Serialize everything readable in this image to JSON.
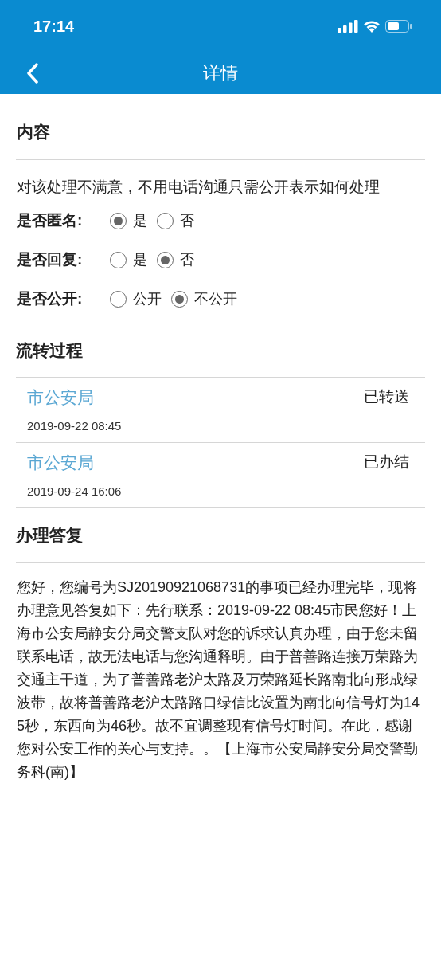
{
  "status_bar": {
    "time": "17:14"
  },
  "nav": {
    "title": "详情"
  },
  "content_section": {
    "heading": "内容",
    "text": "对该处理不满意，不用电话沟通只需公开表示如何处理",
    "fields": [
      {
        "label": "是否匿名:",
        "options": [
          {
            "label": "是",
            "selected": true
          },
          {
            "label": "否",
            "selected": false
          }
        ]
      },
      {
        "label": "是否回复:",
        "options": [
          {
            "label": "是",
            "selected": false
          },
          {
            "label": "否",
            "selected": true
          }
        ]
      },
      {
        "label": "是否公开:",
        "options": [
          {
            "label": "公开",
            "selected": false
          },
          {
            "label": "不公开",
            "selected": true
          }
        ]
      }
    ]
  },
  "flow_section": {
    "heading": "流转过程",
    "records": [
      {
        "department": "市公安局",
        "time": "2019-09-22 08:45",
        "status": "已转送"
      },
      {
        "department": "市公安局",
        "time": "2019-09-24 16:06",
        "status": "已办结"
      }
    ]
  },
  "reply_section": {
    "heading": "办理答复",
    "text": "您好，您编号为SJ20190921068731的事项已经办理完毕，现将办理意见答复如下：先行联系：2019-09-22 08:45市民您好！上海市公安局静安分局交警支队对您的诉求认真办理，由于您未留联系电话，故无法电话与您沟通释明。由于普善路连接万荣路为交通主干道，为了普善路老沪太路及万荣路延长路南北向形成绿波带，故将普善路老沪太路路口绿信比设置为南北向信号灯为145秒，东西向为46秒。故不宜调整现有信号灯时间。在此，感谢您对公安工作的关心与支持。。【上海市公安局静安分局交警勤务科(南)】"
  }
}
